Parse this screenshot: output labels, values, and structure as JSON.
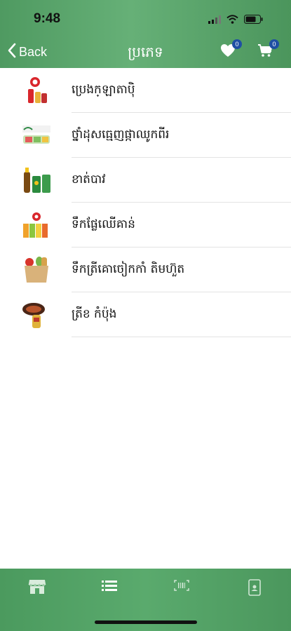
{
  "status_bar": {
    "time": "9:48"
  },
  "nav": {
    "back_label": "Back",
    "title": "ប្រភេទ",
    "favorites_count": "0",
    "cart_count": "0"
  },
  "categories": [
    {
      "label": "ប្រេងក្ឡាតាប៉ិ",
      "icon": "oil-bottle-products"
    },
    {
      "label": "ថ្នាំដុសធ្មេញផ្កាឈូកពីរ",
      "icon": "toothpaste-products"
    },
    {
      "label": "ខាត់បាវ",
      "icon": "energy-drink-products"
    },
    {
      "label": "ទឹកផ្លែឈើគាន់",
      "icon": "juice-products"
    },
    {
      "label": "ទឹកត្រីគោចៀកកាំ តិមហ៊ួត",
      "icon": "grocery-bag"
    },
    {
      "label": "ត្រីខ កំប៉ុង",
      "icon": "canned-fish"
    }
  ],
  "tabbar": {
    "tabs": [
      "store-icon",
      "list-icon",
      "barcode-icon",
      "phone-icon"
    ]
  },
  "colors": {
    "header_green": "#5fa870",
    "tabbar_green": "#52a366",
    "badge_blue": "#1f4fa3"
  }
}
